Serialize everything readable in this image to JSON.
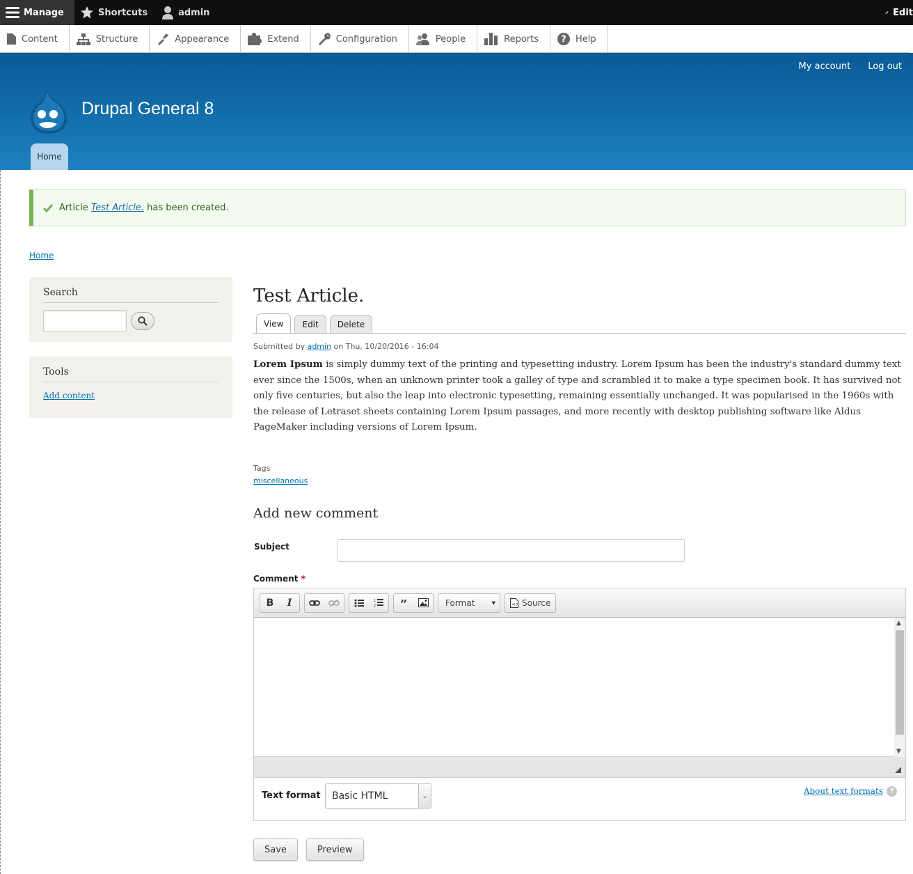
{
  "admin_toolbar": {
    "manage_label": "Manage",
    "shortcuts_label": "Shortcuts",
    "user_label": "admin",
    "edit_label": "Edit"
  },
  "admin_tray": [
    {
      "label": "Content",
      "icon": "file-icon"
    },
    {
      "label": "Structure",
      "icon": "sitemap-icon"
    },
    {
      "label": "Appearance",
      "icon": "paintbrush-icon"
    },
    {
      "label": "Extend",
      "icon": "puzzle-icon"
    },
    {
      "label": "Configuration",
      "icon": "wrench-icon"
    },
    {
      "label": "People",
      "icon": "people-icon"
    },
    {
      "label": "Reports",
      "icon": "bar-chart-icon"
    },
    {
      "label": "Help",
      "icon": "help-icon"
    }
  ],
  "header": {
    "my_account": "My account",
    "log_out": "Log out",
    "site_name": "Drupal General 8",
    "home_tab": "Home"
  },
  "status": {
    "prefix": "Article",
    "link": "Test Article.",
    "suffix": "has been created."
  },
  "breadcrumb": {
    "home": "Home"
  },
  "sidebar": {
    "search_title": "Search",
    "tools_title": "Tools",
    "add_content": "Add content"
  },
  "article": {
    "title": "Test Article.",
    "tabs": [
      "View",
      "Edit",
      "Delete"
    ],
    "submitted_prefix": "Submitted by",
    "author": "admin",
    "submitted_date": "on Thu, 10/20/2016 - 16:04",
    "body_bold": "Lorem Ipsum",
    "body_rest": " is simply dummy text of the printing and typesetting industry. Lorem Ipsum has been the industry's standard dummy text ever since the 1500s, when an unknown printer took a galley of type and scrambled it to make a type specimen book. It has survived not only five centuries, but also the leap into electronic typesetting, remaining essentially unchanged. It was popularised in the 1960s with the release of Letraset sheets containing Lorem Ipsum passages, and more recently with desktop publishing software like Aldus PageMaker including versions of Lorem Ipsum.",
    "tags_label": "Tags",
    "tag": "miscellaneous"
  },
  "comment_form": {
    "title": "Add new comment",
    "subject_label": "Subject",
    "subject_value": "",
    "comment_label": "Comment",
    "required_mark": "*",
    "format_combo": "Format",
    "source_button": "Source",
    "text_format_label": "Text format",
    "text_format_value": "Basic HTML",
    "about_text_formats": "About text formats",
    "help_mark": "?",
    "save_button": "Save",
    "preview_button": "Preview"
  },
  "colors": {
    "toolbar_bg": "#0f0f0f",
    "header_top": "#0a5a96",
    "header_bottom": "#1c80c0",
    "link": "#0071b3",
    "status_border": "#77b259"
  }
}
